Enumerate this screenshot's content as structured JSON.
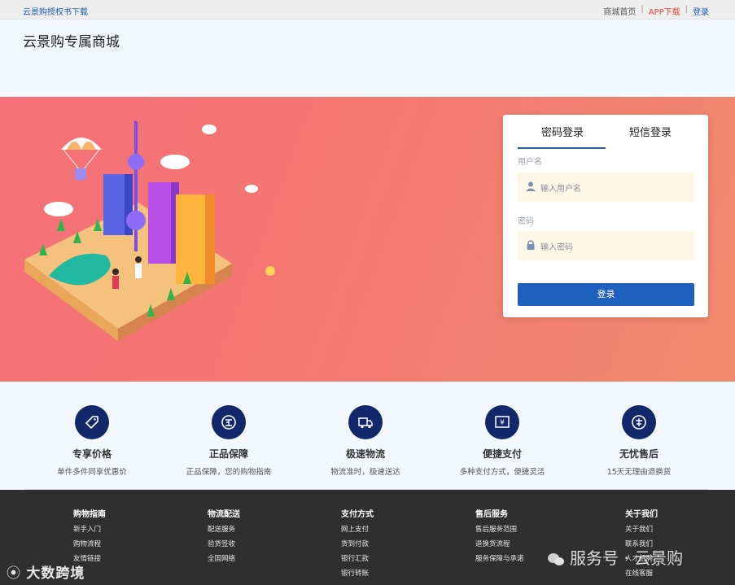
{
  "topbar": {
    "left_link": "云景购授权书下载",
    "links": {
      "home": "商城首页",
      "sep": "|",
      "app": "APP下载",
      "login": "登录"
    }
  },
  "brand": {
    "title": "云景购专属商城"
  },
  "login": {
    "tabs": {
      "password": "密码登录",
      "sms": "短信登录"
    },
    "username_label": "用户名",
    "username_placeholder": "输入用户名",
    "password_label": "密码",
    "password_placeholder": "输入密码",
    "submit": "登录"
  },
  "features": [
    {
      "title": "专享价格",
      "desc": "单件多件同享优惠价",
      "icon": "price-tag-icon"
    },
    {
      "title": "正品保障",
      "desc": "正品保障，您的购物指南",
      "icon": "genuine-icon"
    },
    {
      "title": "极速物流",
      "desc": "物流准时，极速送达",
      "icon": "truck-icon"
    },
    {
      "title": "便捷支付",
      "desc": "多种支付方式，便捷灵活",
      "icon": "payment-icon"
    },
    {
      "title": "无忧售后",
      "desc": "15天无理由退换货",
      "icon": "aftersale-icon"
    }
  ],
  "footer": {
    "columns": [
      {
        "title": "购物指南",
        "items": [
          "新手入门",
          "购物流程",
          "友情链接"
        ]
      },
      {
        "title": "物流配送",
        "items": [
          "配送服务",
          "验货签收",
          "全国网络"
        ]
      },
      {
        "title": "支付方式",
        "items": [
          "网上支付",
          "货到付款",
          "银行汇款",
          "银行转账"
        ]
      },
      {
        "title": "售后服务",
        "items": [
          "售后服务范围",
          "退换货流程",
          "服务保障与承诺"
        ]
      },
      {
        "title": "关于我们",
        "items": [
          "关于我们",
          "联系我们",
          "人才招聘",
          "在线客服"
        ]
      }
    ]
  },
  "watermarks": {
    "left": "大数跨境",
    "right": "服务号 · 云景购"
  },
  "colors": {
    "accent": "#1f5fbf",
    "hero_start": "#f56f78",
    "hero_end": "#f08a6d",
    "footer": "#2f2f2f",
    "feature_circle": "#13286a"
  }
}
